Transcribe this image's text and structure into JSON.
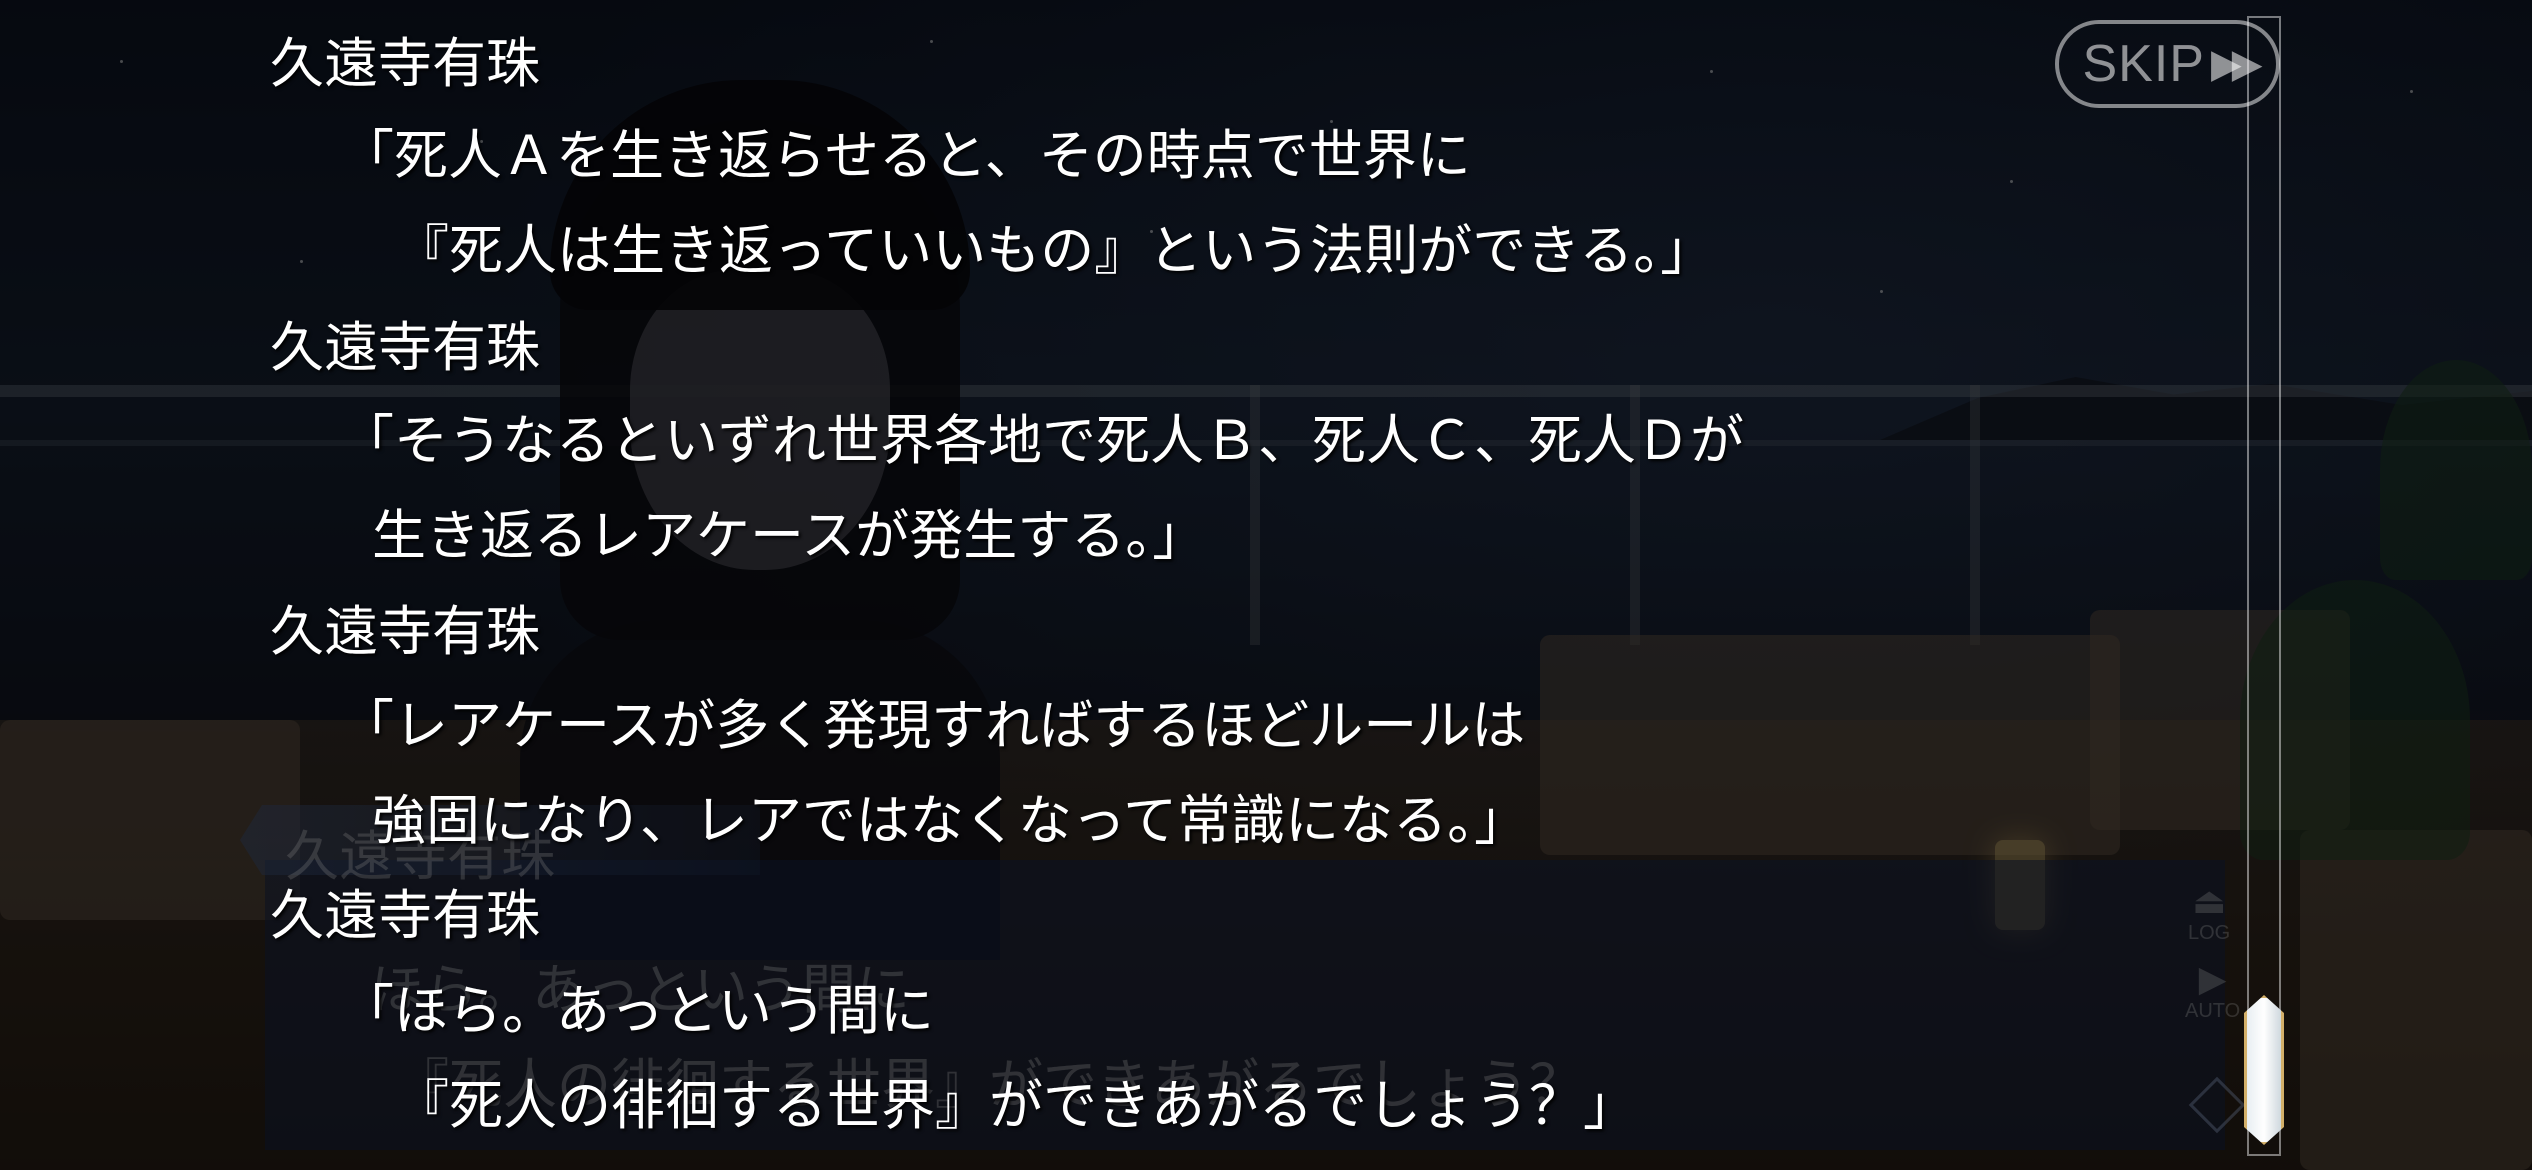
{
  "skip": {
    "label": "SKIP"
  },
  "log": [
    {
      "speaker": "久遠寺有珠",
      "lines": [
        "「死人Ａを生き返らせると、その時点で世界に",
        "『死人は生き返っていいもの』という法則ができる。」"
      ]
    },
    {
      "speaker": "久遠寺有珠",
      "lines": [
        "「そうなるといずれ世界各地で死人Ｂ、死人Ｃ、死人Ｄが",
        "生き返るレアケースが発生する。」"
      ]
    },
    {
      "speaker": "久遠寺有珠",
      "lines": [
        "「レアケースが多く発現すればするほどルールは",
        "強固になり、レアではなくなって常識になる。」"
      ]
    },
    {
      "speaker": "久遠寺有珠",
      "lines": [
        "「ほら。あっという間に",
        "『死人の徘徊する世界』ができあがるでしょう？」"
      ]
    }
  ],
  "background_textbox": {
    "speaker": "久遠寺有珠",
    "lines": [
      "ほら。あっという間に",
      "『死人の徘徊する世界』ができあがるでしょう？"
    ]
  },
  "side_controls": {
    "log_label": "LOG",
    "auto_label": "AUTO"
  },
  "scrollbar": {
    "position": 1.0
  },
  "icons": {
    "skip": "fast-forward-icon",
    "log": "log-icon",
    "auto": "play-icon",
    "menu": "diamond-icon"
  }
}
